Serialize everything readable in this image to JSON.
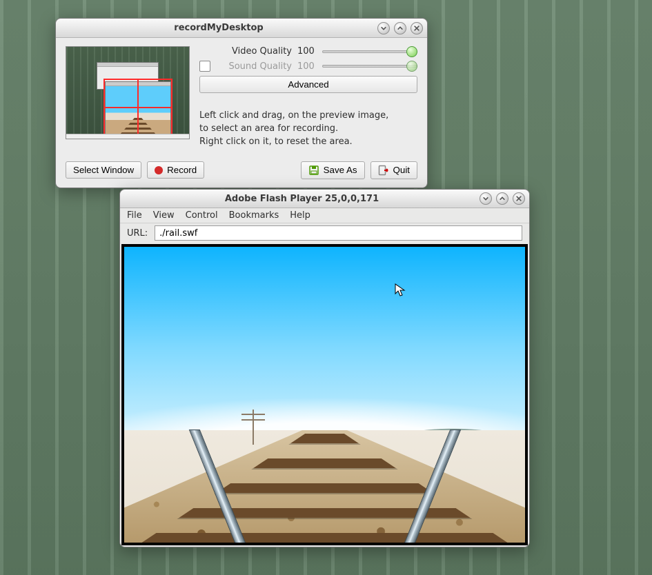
{
  "rmd": {
    "title": "recordMyDesktop",
    "video": {
      "label": "Video Quality",
      "value": "100"
    },
    "sound": {
      "label": "Sound Quality",
      "value": "100",
      "enabled": false
    },
    "advanced_label": "Advanced",
    "help_line1": "Left click and drag, on the preview image,",
    "help_line2": "to select an area for recording.",
    "help_line3": "Right click on it, to reset the area.",
    "select_window_label": "Select Window",
    "record_label": "Record",
    "save_as_label": "Save As",
    "quit_label": "Quit"
  },
  "flash": {
    "title": "Adobe Flash Player 25,0,0,171",
    "menu": {
      "file": "File",
      "view": "View",
      "control": "Control",
      "bookmarks": "Bookmarks",
      "help": "Help"
    },
    "url_label": "URL:",
    "url_value": "./rail.swf"
  }
}
